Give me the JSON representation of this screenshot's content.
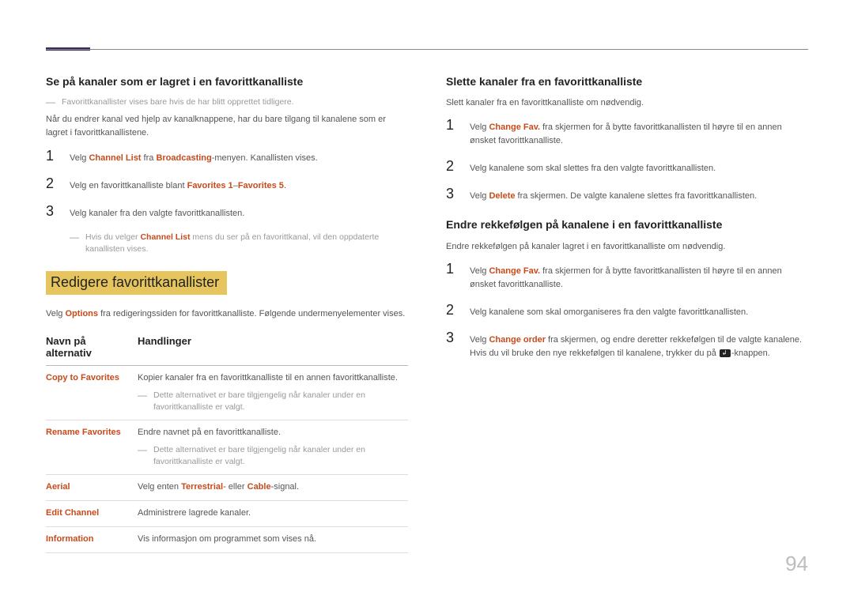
{
  "page_number": "94",
  "left": {
    "sec1": {
      "heading": "Se på kanaler som er lagret i en favorittkanalliste",
      "note1": "Favorittkanallister vises bare hvis de har blitt opprettet tidligere.",
      "intro": "Når du endrer kanal ved hjelp av kanalknappene, har du bare tilgang til kanalene som er lagret i favorittkanallistene.",
      "step1a": "Velg ",
      "step1b": "Channel List",
      "step1c": " fra ",
      "step1d": "Broadcasting",
      "step1e": "-menyen. Kanallisten vises.",
      "step2a": "Velg en favorittkanalliste blant ",
      "step2b": "Favorites 1",
      "step2c": "–",
      "step2d": "Favorites 5",
      "step2e": ".",
      "step3": "Velg kanaler fra den valgte favorittkanallisten.",
      "note2a": "Hvis du velger ",
      "note2b": "Channel List",
      "note2c": " mens du ser på en favorittkanal, vil den oppdaterte kanallisten vises."
    },
    "sec2": {
      "heading": "Redigere favorittkanallister",
      "intro_a": "Velg ",
      "intro_b": "Options",
      "intro_c": " fra redigeringssiden for favorittkanalliste. Følgende undermenyelementer vises."
    },
    "table": {
      "th1": "Navn på alternativ",
      "th2": "Handlinger",
      "rows": [
        {
          "name": "Copy to Favorites",
          "desc": "Kopier kanaler fra en favorittkanalliste til en annen favorittkanalliste.",
          "note": "Dette alternativet er bare tilgjengelig når kanaler under en favorittkanalliste er valgt."
        },
        {
          "name": "Rename Favorites",
          "desc": "Endre navnet på en favorittkanalliste.",
          "note": "Dette alternativet er bare tilgjengelig når kanaler under en favorittkanalliste er valgt."
        },
        {
          "name": "Aerial",
          "desc_a": "Velg enten ",
          "desc_b": "Terrestrial",
          "desc_c": "- eller ",
          "desc_d": "Cable",
          "desc_e": "-signal."
        },
        {
          "name": "Edit Channel",
          "desc": "Administrere lagrede kanaler."
        },
        {
          "name": "Information",
          "desc": "Vis informasjon om programmet som vises nå."
        }
      ]
    }
  },
  "right": {
    "sec1": {
      "heading": "Slette kanaler fra en favorittkanalliste",
      "intro": "Slett kanaler fra en favorittkanalliste om nødvendig.",
      "step1a": "Velg ",
      "step1b": "Change Fav.",
      "step1c": " fra skjermen for å bytte favorittkanallisten til høyre til en annen ønsket favorittkanalliste.",
      "step2": "Velg kanalene som skal slettes fra den valgte favorittkanallisten.",
      "step3a": "Velg ",
      "step3b": "Delete",
      "step3c": " fra skjermen. De valgte kanalene slettes fra favorittkanallisten."
    },
    "sec2": {
      "heading": "Endre rekkefølgen på kanalene i en favorittkanalliste",
      "intro": "Endre rekkefølgen på kanaler lagret i en favorittkanalliste om nødvendig.",
      "step1a": "Velg ",
      "step1b": "Change Fav.",
      "step1c": " fra skjermen for å bytte favorittkanallisten til høyre til en annen ønsket favorittkanalliste.",
      "step2": "Velg kanalene som skal omorganiseres fra den valgte favorittkanallisten.",
      "step3a": "Velg ",
      "step3b": "Change order",
      "step3c": " fra skjermen, og endre deretter rekkefølgen til de valgte kanalene. Hvis du vil bruke den nye rekkefølgen til kanalene, trykker du på ",
      "step3d": "-knappen."
    }
  }
}
